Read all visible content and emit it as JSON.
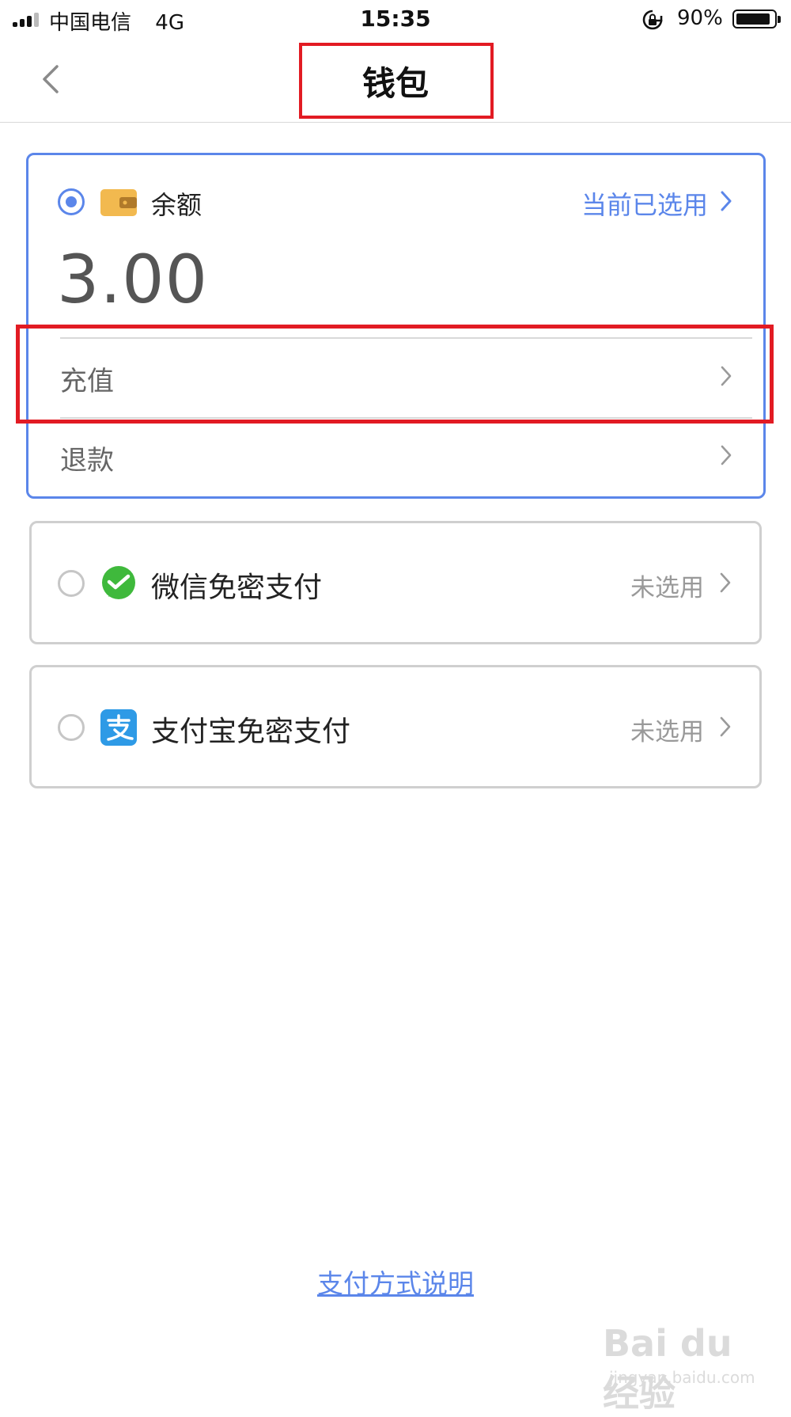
{
  "status_bar": {
    "carrier": "中国电信",
    "network": "4G",
    "time": "15:35",
    "battery": "90%"
  },
  "nav": {
    "title": "钱包"
  },
  "balance_card": {
    "label": "余额",
    "status": "当前已选用",
    "amount": "3.00",
    "rows": [
      {
        "label": "充值"
      },
      {
        "label": "退款"
      }
    ]
  },
  "payment_methods": [
    {
      "label": "微信免密支付",
      "status": "未选用",
      "icon": "wechat-icon"
    },
    {
      "label": "支付宝免密支付",
      "status": "未选用",
      "icon": "alipay-icon"
    }
  ],
  "footer": {
    "link": "支付方式说明"
  },
  "watermark": {
    "logo": "Bai du 经验",
    "url": "jingyan.baidu.com"
  },
  "colors": {
    "accent": "#5b86ea",
    "highlight": "#e21b23",
    "wechat": "#3fb93c",
    "alipay": "#2e9ae6",
    "wallet": "#f2b94f"
  }
}
